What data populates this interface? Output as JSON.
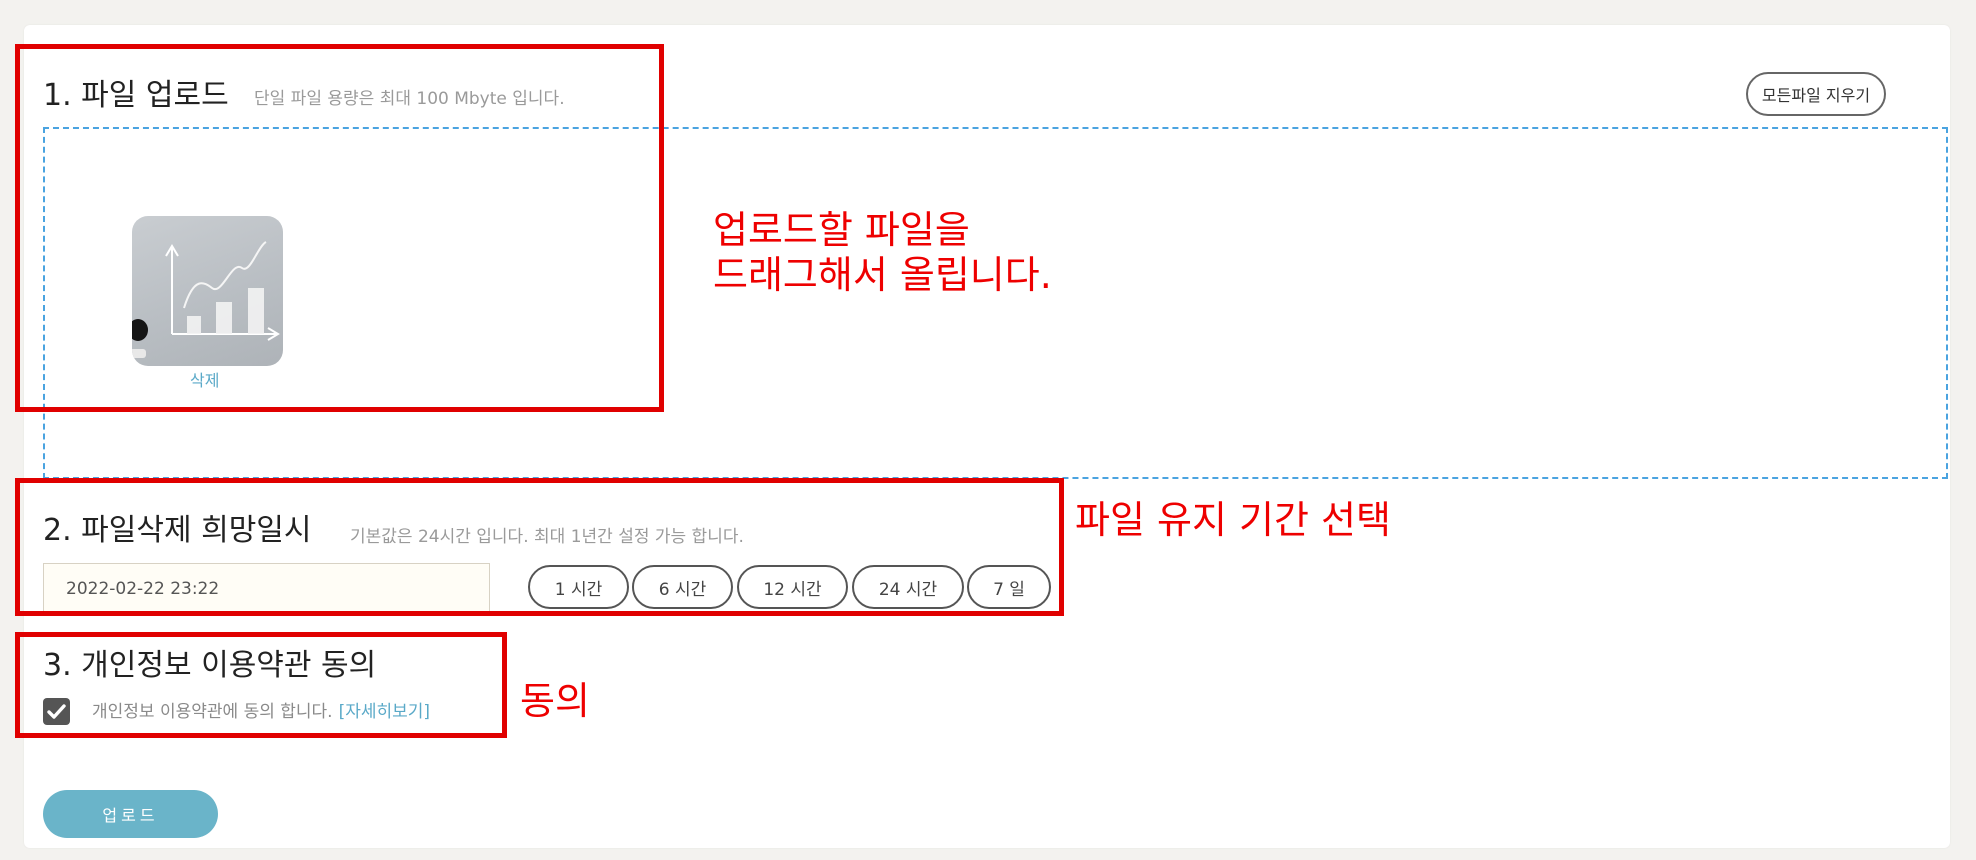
{
  "section1": {
    "title": "1. 파일 업로드",
    "subtitle": "단일 파일 용량은 최대 100 Mbyte 입니다.",
    "clear_all_label": "모든파일 지우기",
    "file_item": {
      "delete_label": "삭제",
      "thumbnail": "chart-image-thumbnail"
    }
  },
  "section2": {
    "title": "2. 파일삭제 희망일시",
    "subtitle": "기본값은 24시간 입니다. 최대 1년간 설정 가능 합니다.",
    "date_value": "2022-02-22 23:22",
    "durations": [
      "1 시간",
      "6 시간",
      "12 시간",
      "24 시간",
      "7 일"
    ]
  },
  "section3": {
    "title": "3. 개인정보 이용약관 동의",
    "checked": true,
    "agree_text": "개인정보 이용약관에 동의 합니다.",
    "detail_link": "[자세히보기]"
  },
  "upload_button": "업로드",
  "annotations": {
    "drag_line1": "업로드할 파일을",
    "drag_line2": "드래그해서 올립니다.",
    "retention": "파일 유지 기간 선택",
    "agree": "동의"
  },
  "colors": {
    "highlight_box": "#e00000",
    "dropzone_border": "#4aa3e0",
    "accent": "#6ab4c9",
    "link": "#5aa9c8"
  }
}
